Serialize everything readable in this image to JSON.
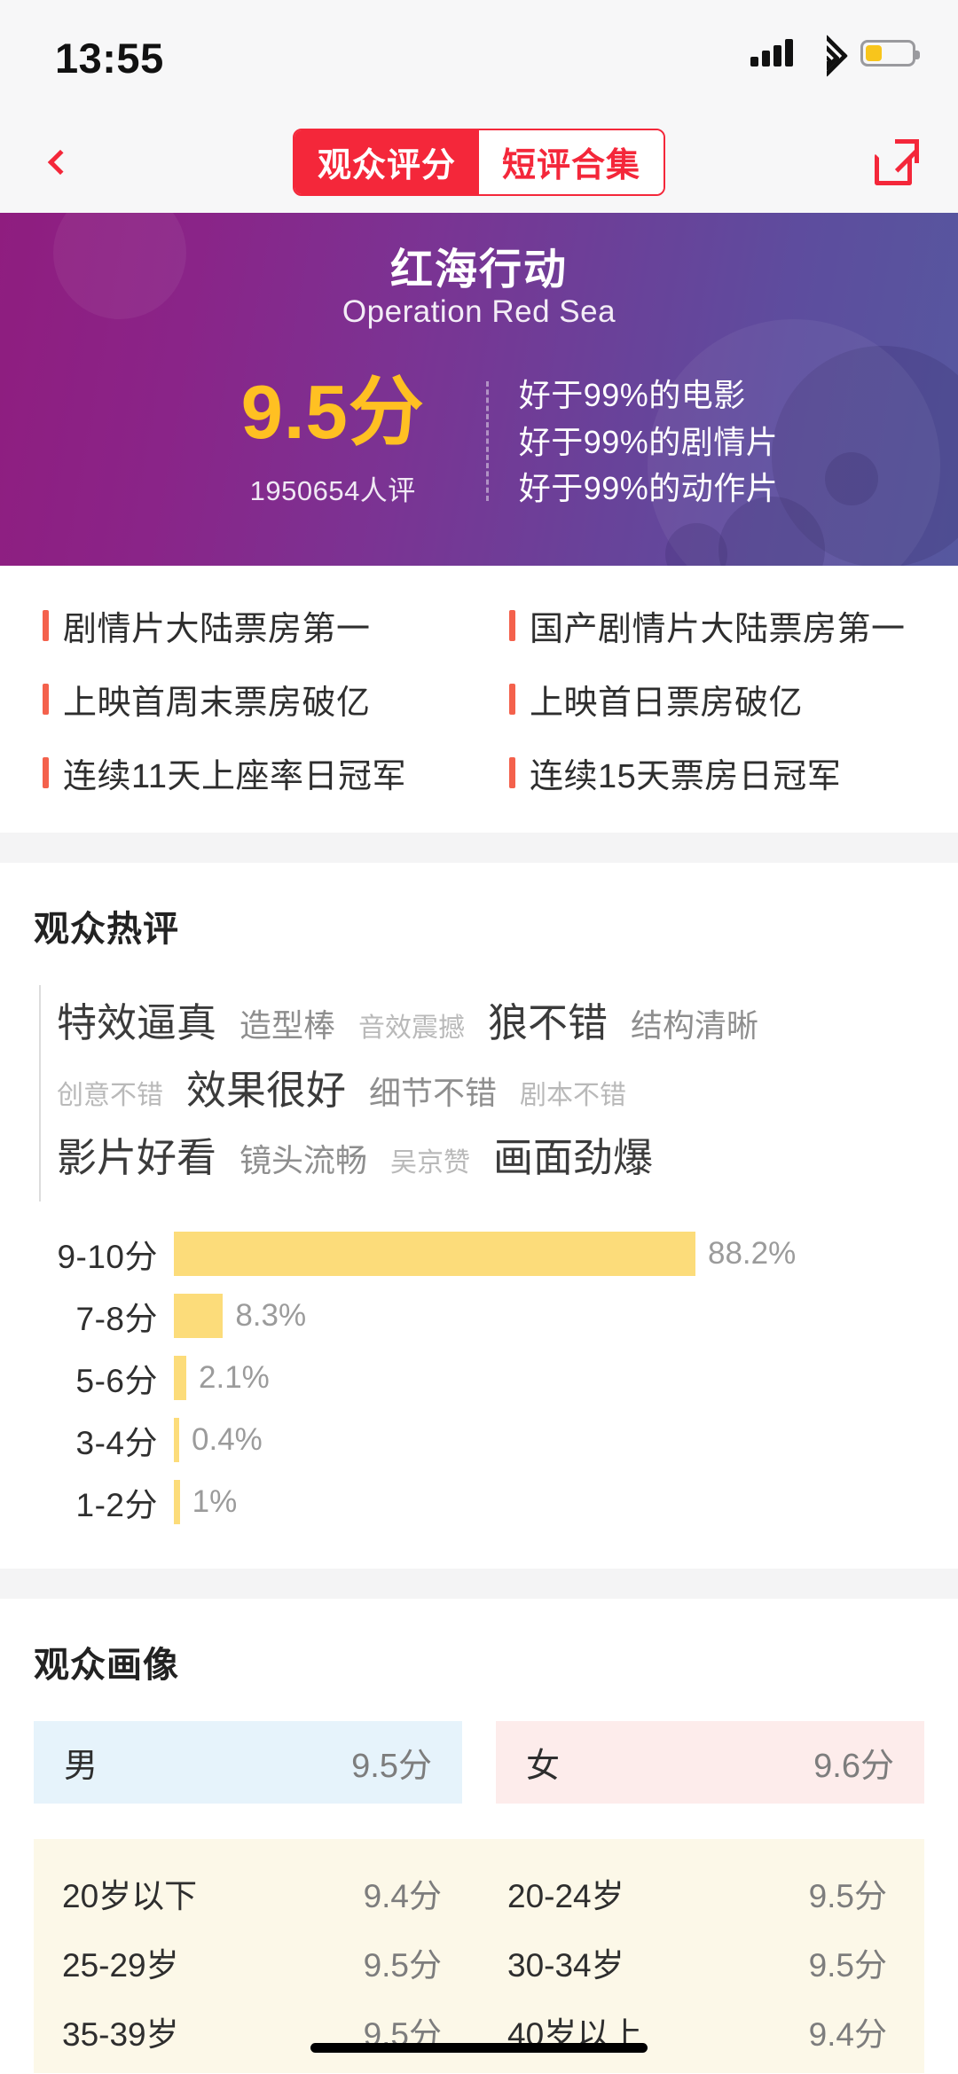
{
  "status_bar": {
    "time": "13:55",
    "signal_icon": "signal-bars-icon",
    "wifi_icon": "wifi-icon",
    "battery_icon": "battery-icon",
    "battery_level_percent": 36
  },
  "nav": {
    "back_icon": "chevron-left-icon",
    "share_icon": "share-external-icon",
    "tabs": [
      {
        "label": "观众评分",
        "active": true
      },
      {
        "label": "短评合集",
        "active": false
      }
    ],
    "accent_color": "#f4273a"
  },
  "hero": {
    "title": "红海行动",
    "subtitle": "Operation Red Sea",
    "score": "9.5分",
    "score_color": "#ffc022",
    "rating_count": "1950654人评",
    "comparisons": [
      "好于99%的电影",
      "好于99%的剧情片",
      "好于99%的动作片"
    ],
    "gradient_from": "#8f1d7f",
    "gradient_to": "#56589f"
  },
  "achievements": {
    "marker_color": "#f4614c",
    "items": [
      "剧情片大陆票房第一",
      "国产剧情片大陆票房第一",
      "上映首周末票房破亿",
      "上映首日票房破亿",
      "连续11天上座率日冠军",
      "连续15天票房日冠军"
    ]
  },
  "hot_comments": {
    "title": "观众热评",
    "tag_rows": [
      [
        {
          "text": "特效逼真",
          "size": "lg"
        },
        {
          "text": "造型棒",
          "size": "md"
        },
        {
          "text": "音效震撼",
          "size": "sm"
        },
        {
          "text": "狼不错",
          "size": "lg"
        },
        {
          "text": "结构清晰",
          "size": "md"
        }
      ],
      [
        {
          "text": "创意不错",
          "size": "sm"
        },
        {
          "text": "效果很好",
          "size": "lg"
        },
        {
          "text": "细节不错",
          "size": "md"
        },
        {
          "text": "剧本不错",
          "size": "sm"
        }
      ],
      [
        {
          "text": "影片好看",
          "size": "lg"
        },
        {
          "text": "镜头流畅",
          "size": "md"
        },
        {
          "text": "吴京赞",
          "size": "sm"
        },
        {
          "text": "画面劲爆",
          "size": "lg"
        }
      ]
    ]
  },
  "chart_data": {
    "type": "bar",
    "title": "",
    "orientation": "horizontal",
    "categories": [
      "9-10分",
      "7-8分",
      "5-6分",
      "3-4分",
      "1-2分"
    ],
    "values": [
      88.2,
      8.3,
      2.1,
      0.4,
      1
    ],
    "value_labels": [
      "88.2%",
      "8.3%",
      "2.1%",
      "0.4%",
      "1%"
    ],
    "xlabel": "",
    "ylabel": "",
    "xlim": [
      0,
      100
    ],
    "grid": false,
    "legend": false,
    "bar_color": "#fcdc7a",
    "label_color": "#9b9b9b"
  },
  "audience_profile": {
    "title": "观众画像",
    "gender": [
      {
        "label": "男",
        "score": "9.5分",
        "bg": "#e6f3fb"
      },
      {
        "label": "女",
        "score": "9.6分",
        "bg": "#fdeceb"
      }
    ],
    "age_groups": [
      {
        "label": "20岁以下",
        "score": "9.4分"
      },
      {
        "label": "20-24岁",
        "score": "9.5分"
      },
      {
        "label": "25-29岁",
        "score": "9.5分"
      },
      {
        "label": "30-34岁",
        "score": "9.5分"
      },
      {
        "label": "35-39岁",
        "score": "9.5分"
      },
      {
        "label": "40岁以上",
        "score": "9.4分"
      }
    ],
    "age_panel_bg": "#fcf8e8"
  }
}
